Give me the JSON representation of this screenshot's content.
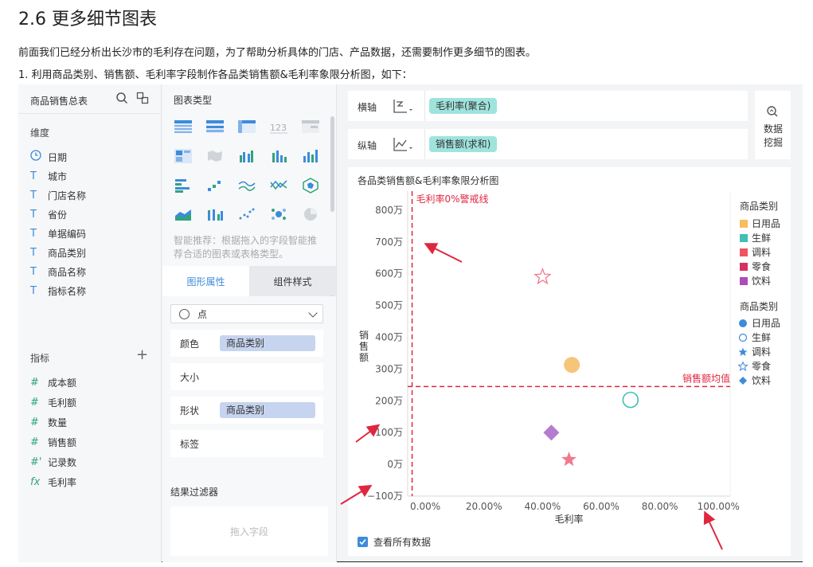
{
  "doc": {
    "title": "2.6 更多细节图表",
    "para1": "前面我们已经分析出长沙市的毛利存在问题，为了帮助分析具体的门店、产品数据，还需要制作更多细节的图表。",
    "para2": "1. 利用商品类别、销售额、毛利率字段制作各品类销售额&毛利率象限分析图，如下："
  },
  "data_panel": {
    "title": "商品销售总表",
    "dimensions_label": "维度",
    "dimensions": [
      {
        "type": "clock-icon",
        "label": "日期"
      },
      {
        "type": "T",
        "label": "城市"
      },
      {
        "type": "T",
        "label": "门店名称"
      },
      {
        "type": "T",
        "label": "省份"
      },
      {
        "type": "T",
        "label": "单据编码"
      },
      {
        "type": "T",
        "label": "商品类别"
      },
      {
        "type": "T",
        "label": "商品名称"
      },
      {
        "type": "T",
        "label": "指标名称"
      }
    ],
    "measures_label": "指标",
    "measures": [
      {
        "type": "#",
        "label": "成本额"
      },
      {
        "type": "#",
        "label": "毛利额"
      },
      {
        "type": "#",
        "label": "数量"
      },
      {
        "type": "#",
        "label": "销售额"
      },
      {
        "type": "#'",
        "label": "记录数"
      },
      {
        "type": "fx",
        "label": "毛利率"
      }
    ]
  },
  "config_panel": {
    "chart_types_label": "图表类型",
    "smart_tip": "智能推荐：根据拖入的字段智能推荐合适的图表或表格类型。",
    "tab_graphic": "图形属性",
    "tab_component": "组件样式",
    "mark_type": "点",
    "rows": [
      {
        "label": "颜色",
        "pill": "商品类别"
      },
      {
        "label": "大小",
        "pill": ""
      },
      {
        "label": "形状",
        "pill": "商品类别"
      },
      {
        "label": "标签",
        "pill": ""
      }
    ],
    "filter_title": "结果过滤器",
    "filter_placeholder": "拖入字段"
  },
  "axes": {
    "x_label": "横轴",
    "x_field": "毛利率(聚合)",
    "y_label": "纵轴",
    "y_field": "销售额(求和)"
  },
  "data_mining": {
    "label": "数据挖掘",
    "icon": "search-chart-icon"
  },
  "chart_data": {
    "type": "scatter",
    "title": "各品类销售额&毛利率象限分析图",
    "xlabel": "毛利率",
    "ylabel": "销售额",
    "x_ticks": [
      "0.00%",
      "20.00%",
      "40.00%",
      "60.00%",
      "80.00%",
      "100.00%"
    ],
    "y_ticks": [
      "800万",
      "700万",
      "600万",
      "500万",
      "400万",
      "300万",
      "200万",
      "100万",
      "0万",
      "−100万"
    ],
    "xlim": [
      -0.06,
      1.04
    ],
    "ylim": [
      -100,
      860
    ],
    "reference_lines": [
      {
        "axis": "x",
        "value": -0.045,
        "label": "毛利率0%警戒线",
        "color": "#e0263f"
      },
      {
        "axis": "y",
        "value": 245,
        "label": "销售额均值",
        "color": "#e0263f"
      }
    ],
    "points": [
      {
        "category": "日用品",
        "x": 0.5,
        "y": 313,
        "color": "#f6c57a",
        "shape": "circle-filled"
      },
      {
        "category": "生鲜",
        "x": 0.7,
        "y": 203,
        "color": "#3fbfb6",
        "shape": "circle-hollow"
      },
      {
        "category": "调料",
        "x": 0.49,
        "y": 15,
        "color": "#f07a8d",
        "shape": "star-filled"
      },
      {
        "category": "零食",
        "x": 0.4,
        "y": 590,
        "color": "#f07a8d",
        "shape": "star-hollow"
      },
      {
        "category": "饮料",
        "x": 0.43,
        "y": 100,
        "color": "#b57bcf",
        "shape": "diamond"
      }
    ],
    "legend_color_title": "商品类别",
    "legend_color": [
      {
        "label": "日用品",
        "color": "#f6bd5c"
      },
      {
        "label": "生鲜",
        "color": "#3fbfb6"
      },
      {
        "label": "调料",
        "color": "#f0545f"
      },
      {
        "label": "零食",
        "color": "#d8305f"
      },
      {
        "label": "饮料",
        "color": "#ad4bb8"
      }
    ],
    "legend_shape_title": "商品类别",
    "legend_shape": [
      {
        "label": "日用品",
        "shape": "circle-filled"
      },
      {
        "label": "生鲜",
        "shape": "circle-hollow"
      },
      {
        "label": "调料",
        "shape": "star-filled"
      },
      {
        "label": "零食",
        "shape": "star-hollow"
      },
      {
        "label": "饮料",
        "shape": "diamond"
      }
    ],
    "show_all_label": "查看所有数据"
  },
  "colors": {
    "accent": "#3d8bdb",
    "annotation_red": "#e0263f"
  }
}
